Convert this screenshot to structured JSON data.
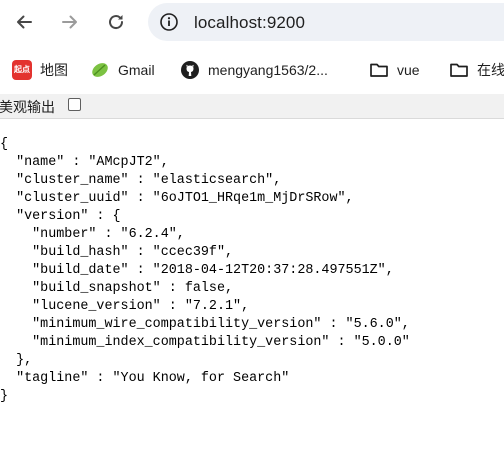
{
  "browser": {
    "url": "localhost:9200",
    "nav": {
      "back_icon": "arrow-left-icon",
      "forward_icon": "arrow-right-icon",
      "reload_icon": "reload-icon",
      "info_icon": "info-icon"
    }
  },
  "bookmarks": [
    {
      "label": "地图",
      "icon": "qidian-icon",
      "icon_text": "起点"
    },
    {
      "label": "Gmail",
      "icon": "leaf-icon"
    },
    {
      "label": "mengyang1563/2...",
      "icon": "github-icon"
    },
    {
      "label": "vue",
      "icon": "folder-icon"
    },
    {
      "label": "在线",
      "icon": "folder-icon"
    }
  ],
  "pretty_print": {
    "label": "美观输出",
    "checked": false
  },
  "json_lines": [
    "{",
    "  \"name\" : \"AMcpJT2\",",
    "  \"cluster_name\" : \"elasticsearch\",",
    "  \"cluster_uuid\" : \"6oJTO1_HRqe1m_MjDrSRow\",",
    "  \"version\" : {",
    "    \"number\" : \"6.2.4\",",
    "    \"build_hash\" : \"ccec39f\",",
    "    \"build_date\" : \"2018-04-12T20:37:28.497551Z\",",
    "    \"build_snapshot\" : false,",
    "    \"lucene_version\" : \"7.2.1\",",
    "    \"minimum_wire_compatibility_version\" : \"5.6.0\",",
    "    \"minimum_index_compatibility_version\" : \"5.0.0\"",
    "  },",
    "  \"tagline\" : \"You Know, for Search\"",
    "}"
  ],
  "colors": {
    "omnibox_bg": "#eef1f6",
    "pretty_bar_bg": "#f1f1f1",
    "icon_gray": "#5f6368"
  }
}
